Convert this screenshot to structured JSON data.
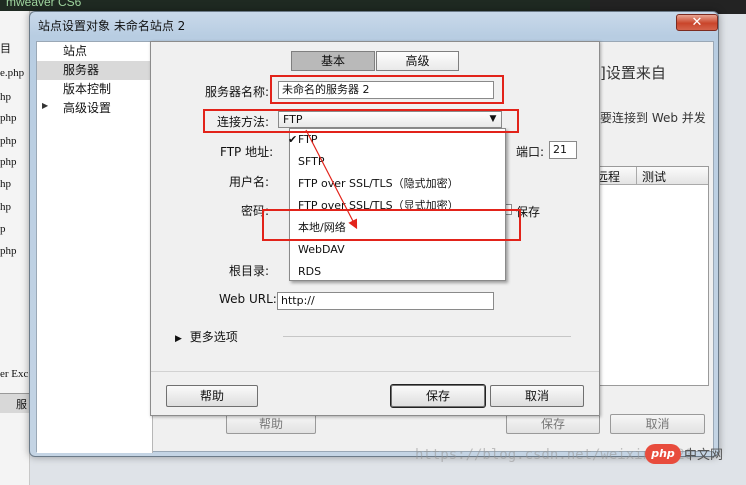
{
  "background_app": {
    "title_fragment": "mweaver CS6",
    "left_files": [
      "目",
      "e.php",
      "hp",
      "php",
      "php",
      "php",
      "hp",
      "hp",
      "p",
      "php"
    ],
    "left_bottom_text": "er Exc",
    "left_tab": "服",
    "desc_line1": "]设置来自",
    "desc_line2": "要连接到 Web 并发",
    "table_headers": [
      "远程",
      "测试"
    ],
    "buttons": {
      "help": "帮助",
      "save": "保存",
      "cancel": "取消"
    }
  },
  "outer_dialog": {
    "title": "站点设置对象 未命名站点 2",
    "close_glyph": "✕",
    "categories": [
      {
        "label": "站点",
        "selected": false
      },
      {
        "label": "服务器",
        "selected": true
      },
      {
        "label": "版本控制",
        "selected": false
      },
      {
        "label": "高级设置",
        "selected": false,
        "expandable": true
      }
    ],
    "expand_glyph": "▶"
  },
  "server_dialog": {
    "tabs": [
      "基本",
      "高级"
    ],
    "active_tab": "基本",
    "fields": {
      "server_name_label": "服务器名称:",
      "server_name_value": "未命名的服务器 2",
      "connect_method_label": "连接方法:",
      "connect_method_value": "FTP",
      "ftp_address_label": "FTP 地址:",
      "port_label": "端口:",
      "port_value": "21",
      "username_label": "用户名:",
      "password_label": "密码:",
      "save_label": "保存",
      "root_dir_label": "根目录:",
      "web_url_label": "Web URL:",
      "web_url_value": "http://"
    },
    "more_options": "更多选项",
    "more_glyph": "▶",
    "buttons": {
      "help": "帮助",
      "save": "保存",
      "cancel": "取消"
    },
    "dropdown_options": [
      {
        "label": "FTP",
        "checked": true
      },
      {
        "label": "SFTP",
        "checked": false
      },
      {
        "label": "FTP over SSL/TLS（隐式加密）",
        "checked": false
      },
      {
        "label": "FTP over SSL/TLS（显式加密）",
        "checked": false
      },
      {
        "label": "本地/网络",
        "checked": false,
        "hovered": true
      },
      {
        "label": "WebDAV",
        "checked": false
      },
      {
        "label": "RDS",
        "checked": false
      }
    ],
    "check_glyph": "✔",
    "dropdown_arrow": "▼"
  },
  "watermark": {
    "url": "https://blog.csdn.net/weixin_4020",
    "badge": "php",
    "site": "中文网"
  },
  "colors": {
    "highlight": "#e2231a",
    "selected_tab": "#b9b9b9",
    "selected_category": "#d9d9d9"
  }
}
